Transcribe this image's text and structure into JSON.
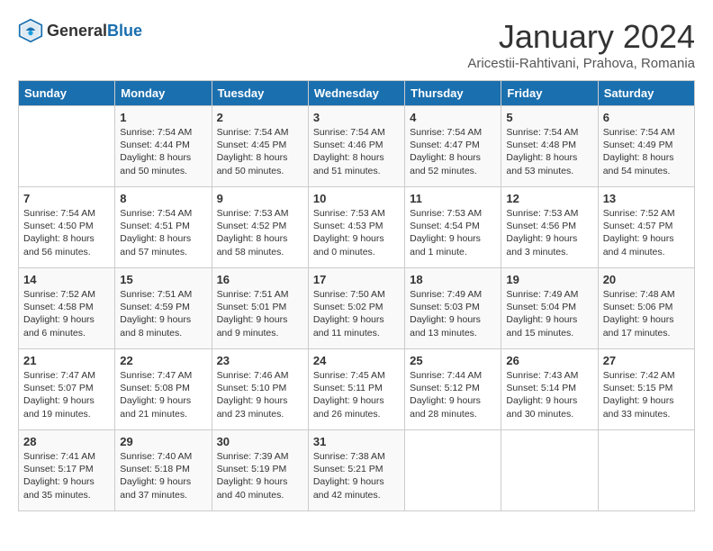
{
  "header": {
    "logo_general": "General",
    "logo_blue": "Blue",
    "month_title": "January 2024",
    "location": "Aricestii-Rahtivani, Prahova, Romania"
  },
  "days_of_week": [
    "Sunday",
    "Monday",
    "Tuesday",
    "Wednesday",
    "Thursday",
    "Friday",
    "Saturday"
  ],
  "weeks": [
    [
      {
        "day": "",
        "info": ""
      },
      {
        "day": "1",
        "info": "Sunrise: 7:54 AM\nSunset: 4:44 PM\nDaylight: 8 hours\nand 50 minutes."
      },
      {
        "day": "2",
        "info": "Sunrise: 7:54 AM\nSunset: 4:45 PM\nDaylight: 8 hours\nand 50 minutes."
      },
      {
        "day": "3",
        "info": "Sunrise: 7:54 AM\nSunset: 4:46 PM\nDaylight: 8 hours\nand 51 minutes."
      },
      {
        "day": "4",
        "info": "Sunrise: 7:54 AM\nSunset: 4:47 PM\nDaylight: 8 hours\nand 52 minutes."
      },
      {
        "day": "5",
        "info": "Sunrise: 7:54 AM\nSunset: 4:48 PM\nDaylight: 8 hours\nand 53 minutes."
      },
      {
        "day": "6",
        "info": "Sunrise: 7:54 AM\nSunset: 4:49 PM\nDaylight: 8 hours\nand 54 minutes."
      }
    ],
    [
      {
        "day": "7",
        "info": "Sunrise: 7:54 AM\nSunset: 4:50 PM\nDaylight: 8 hours\nand 56 minutes."
      },
      {
        "day": "8",
        "info": "Sunrise: 7:54 AM\nSunset: 4:51 PM\nDaylight: 8 hours\nand 57 minutes."
      },
      {
        "day": "9",
        "info": "Sunrise: 7:53 AM\nSunset: 4:52 PM\nDaylight: 8 hours\nand 58 minutes."
      },
      {
        "day": "10",
        "info": "Sunrise: 7:53 AM\nSunset: 4:53 PM\nDaylight: 9 hours\nand 0 minutes."
      },
      {
        "day": "11",
        "info": "Sunrise: 7:53 AM\nSunset: 4:54 PM\nDaylight: 9 hours\nand 1 minute."
      },
      {
        "day": "12",
        "info": "Sunrise: 7:53 AM\nSunset: 4:56 PM\nDaylight: 9 hours\nand 3 minutes."
      },
      {
        "day": "13",
        "info": "Sunrise: 7:52 AM\nSunset: 4:57 PM\nDaylight: 9 hours\nand 4 minutes."
      }
    ],
    [
      {
        "day": "14",
        "info": "Sunrise: 7:52 AM\nSunset: 4:58 PM\nDaylight: 9 hours\nand 6 minutes."
      },
      {
        "day": "15",
        "info": "Sunrise: 7:51 AM\nSunset: 4:59 PM\nDaylight: 9 hours\nand 8 minutes."
      },
      {
        "day": "16",
        "info": "Sunrise: 7:51 AM\nSunset: 5:01 PM\nDaylight: 9 hours\nand 9 minutes."
      },
      {
        "day": "17",
        "info": "Sunrise: 7:50 AM\nSunset: 5:02 PM\nDaylight: 9 hours\nand 11 minutes."
      },
      {
        "day": "18",
        "info": "Sunrise: 7:49 AM\nSunset: 5:03 PM\nDaylight: 9 hours\nand 13 minutes."
      },
      {
        "day": "19",
        "info": "Sunrise: 7:49 AM\nSunset: 5:04 PM\nDaylight: 9 hours\nand 15 minutes."
      },
      {
        "day": "20",
        "info": "Sunrise: 7:48 AM\nSunset: 5:06 PM\nDaylight: 9 hours\nand 17 minutes."
      }
    ],
    [
      {
        "day": "21",
        "info": "Sunrise: 7:47 AM\nSunset: 5:07 PM\nDaylight: 9 hours\nand 19 minutes."
      },
      {
        "day": "22",
        "info": "Sunrise: 7:47 AM\nSunset: 5:08 PM\nDaylight: 9 hours\nand 21 minutes."
      },
      {
        "day": "23",
        "info": "Sunrise: 7:46 AM\nSunset: 5:10 PM\nDaylight: 9 hours\nand 23 minutes."
      },
      {
        "day": "24",
        "info": "Sunrise: 7:45 AM\nSunset: 5:11 PM\nDaylight: 9 hours\nand 26 minutes."
      },
      {
        "day": "25",
        "info": "Sunrise: 7:44 AM\nSunset: 5:12 PM\nDaylight: 9 hours\nand 28 minutes."
      },
      {
        "day": "26",
        "info": "Sunrise: 7:43 AM\nSunset: 5:14 PM\nDaylight: 9 hours\nand 30 minutes."
      },
      {
        "day": "27",
        "info": "Sunrise: 7:42 AM\nSunset: 5:15 PM\nDaylight: 9 hours\nand 33 minutes."
      }
    ],
    [
      {
        "day": "28",
        "info": "Sunrise: 7:41 AM\nSunset: 5:17 PM\nDaylight: 9 hours\nand 35 minutes."
      },
      {
        "day": "29",
        "info": "Sunrise: 7:40 AM\nSunset: 5:18 PM\nDaylight: 9 hours\nand 37 minutes."
      },
      {
        "day": "30",
        "info": "Sunrise: 7:39 AM\nSunset: 5:19 PM\nDaylight: 9 hours\nand 40 minutes."
      },
      {
        "day": "31",
        "info": "Sunrise: 7:38 AM\nSunset: 5:21 PM\nDaylight: 9 hours\nand 42 minutes."
      },
      {
        "day": "",
        "info": ""
      },
      {
        "day": "",
        "info": ""
      },
      {
        "day": "",
        "info": ""
      }
    ]
  ]
}
